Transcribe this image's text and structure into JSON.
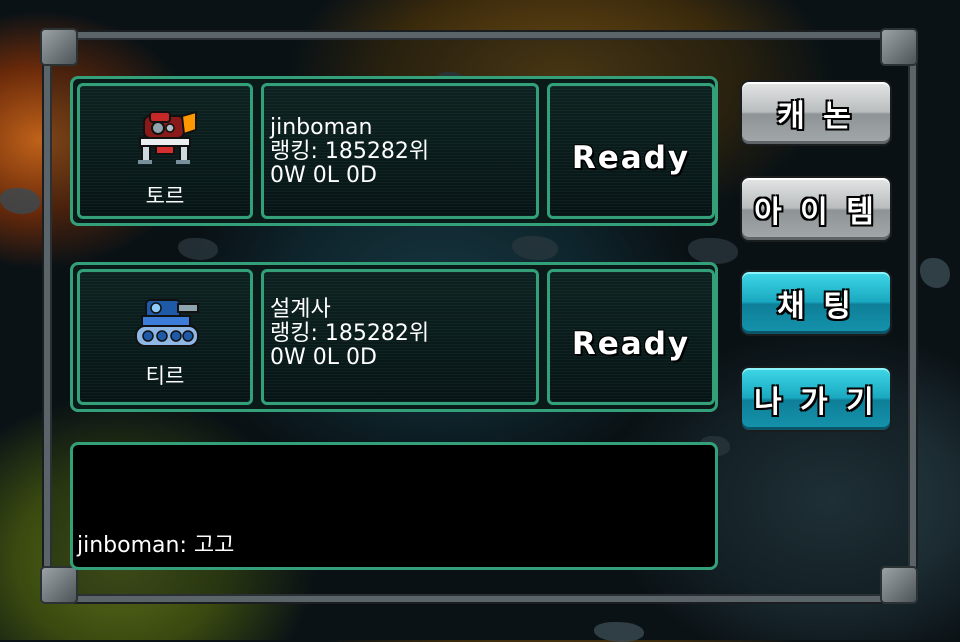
{
  "players": [
    {
      "tank_name": "토르",
      "tank_icon": "orange-red-mech-tank-icon",
      "username": "jinboman",
      "rank": "랭킹: 185282위",
      "record": "0W 0L 0D",
      "status": "Ready"
    },
    {
      "tank_name": "티르",
      "tank_icon": "blue-tread-tank-icon",
      "username": "설계사",
      "rank": "랭킹: 185282위",
      "record": "0W 0L 0D",
      "status": "Ready"
    }
  ],
  "buttons": {
    "cannon": "캐 논",
    "item": "아 이 템",
    "chat": "채 팅",
    "exit": "나 가 기"
  },
  "chat": {
    "messages": [
      "jinboman: 고고"
    ]
  },
  "colors": {
    "panel_border": "#33a07a",
    "gray_button": "#b9bdbe",
    "teal_button": "#1aa9c0"
  }
}
